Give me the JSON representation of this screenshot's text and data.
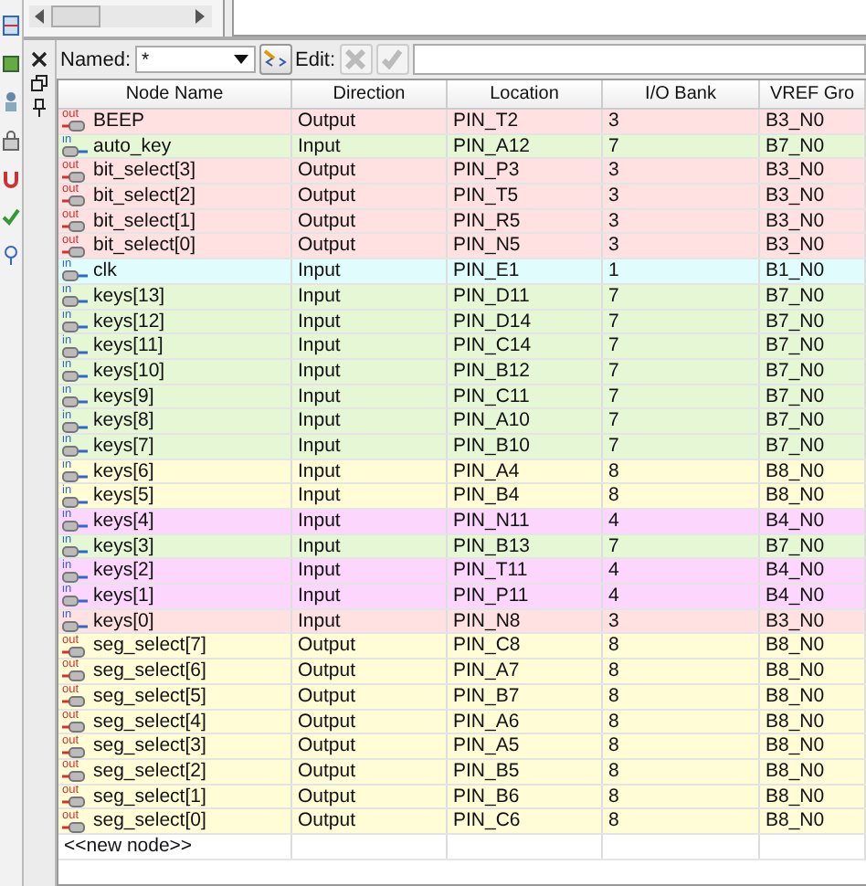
{
  "filter": {
    "label": "Named:",
    "value": "*",
    "edit_label": "Edit:"
  },
  "table": {
    "columns": [
      "Node Name",
      "Direction",
      "Location",
      "I/O Bank",
      "VREF Gro"
    ],
    "rows": [
      {
        "icon_text": "out",
        "kind": "output",
        "name": "BEEP",
        "direction": "Output",
        "location": "PIN_T2",
        "bank": "3",
        "vref": "B3_N0",
        "color": "#ffe1e1"
      },
      {
        "icon_text": "in",
        "kind": "input",
        "name": "auto_key",
        "direction": "Input",
        "location": "PIN_A12",
        "bank": "7",
        "vref": "B7_N0",
        "color": "#e6f7d6"
      },
      {
        "icon_text": "out",
        "kind": "output",
        "name": "bit_select[3]",
        "direction": "Output",
        "location": "PIN_P3",
        "bank": "3",
        "vref": "B3_N0",
        "color": "#ffe1e1"
      },
      {
        "icon_text": "out",
        "kind": "output",
        "name": "bit_select[2]",
        "direction": "Output",
        "location": "PIN_T5",
        "bank": "3",
        "vref": "B3_N0",
        "color": "#ffe1e1"
      },
      {
        "icon_text": "out",
        "kind": "output",
        "name": "bit_select[1]",
        "direction": "Output",
        "location": "PIN_R5",
        "bank": "3",
        "vref": "B3_N0",
        "color": "#ffe1e1"
      },
      {
        "icon_text": "out",
        "kind": "output",
        "name": "bit_select[0]",
        "direction": "Output",
        "location": "PIN_N5",
        "bank": "3",
        "vref": "B3_N0",
        "color": "#ffe1e1"
      },
      {
        "icon_text": "in",
        "kind": "input",
        "name": "clk",
        "direction": "Input",
        "location": "PIN_E1",
        "bank": "1",
        "vref": "B1_N0",
        "color": "#e1fcfc"
      },
      {
        "icon_text": "in",
        "kind": "input",
        "name": "keys[13]",
        "direction": "Input",
        "location": "PIN_D11",
        "bank": "7",
        "vref": "B7_N0",
        "color": "#e6f7d6"
      },
      {
        "icon_text": "in",
        "kind": "input",
        "name": "keys[12]",
        "direction": "Input",
        "location": "PIN_D14",
        "bank": "7",
        "vref": "B7_N0",
        "color": "#e6f7d6"
      },
      {
        "icon_text": "in",
        "kind": "input",
        "name": "keys[11]",
        "direction": "Input",
        "location": "PIN_C14",
        "bank": "7",
        "vref": "B7_N0",
        "color": "#e6f7d6"
      },
      {
        "icon_text": "in",
        "kind": "input",
        "name": "keys[10]",
        "direction": "Input",
        "location": "PIN_B12",
        "bank": "7",
        "vref": "B7_N0",
        "color": "#e6f7d6"
      },
      {
        "icon_text": "in",
        "kind": "input",
        "name": "keys[9]",
        "direction": "Input",
        "location": "PIN_C11",
        "bank": "7",
        "vref": "B7_N0",
        "color": "#e6f7d6"
      },
      {
        "icon_text": "in",
        "kind": "input",
        "name": "keys[8]",
        "direction": "Input",
        "location": "PIN_A10",
        "bank": "7",
        "vref": "B7_N0",
        "color": "#e6f7d6"
      },
      {
        "icon_text": "in",
        "kind": "input",
        "name": "keys[7]",
        "direction": "Input",
        "location": "PIN_B10",
        "bank": "7",
        "vref": "B7_N0",
        "color": "#e6f7d6"
      },
      {
        "icon_text": "in",
        "kind": "input",
        "name": "keys[6]",
        "direction": "Input",
        "location": "PIN_A4",
        "bank": "8",
        "vref": "B8_N0",
        "color": "#fffcd6"
      },
      {
        "icon_text": "in",
        "kind": "input",
        "name": "keys[5]",
        "direction": "Input",
        "location": "PIN_B4",
        "bank": "8",
        "vref": "B8_N0",
        "color": "#fffcd6"
      },
      {
        "icon_text": "in",
        "kind": "input",
        "name": "keys[4]",
        "direction": "Input",
        "location": "PIN_N11",
        "bank": "4",
        "vref": "B4_N0",
        "color": "#fcd6fc"
      },
      {
        "icon_text": "in",
        "kind": "input",
        "name": "keys[3]",
        "direction": "Input",
        "location": "PIN_B13",
        "bank": "7",
        "vref": "B7_N0",
        "color": "#e6f7d6"
      },
      {
        "icon_text": "in",
        "kind": "input",
        "name": "keys[2]",
        "direction": "Input",
        "location": "PIN_T11",
        "bank": "4",
        "vref": "B4_N0",
        "color": "#fcd6fc"
      },
      {
        "icon_text": "in",
        "kind": "input",
        "name": "keys[1]",
        "direction": "Input",
        "location": "PIN_P11",
        "bank": "4",
        "vref": "B4_N0",
        "color": "#fcd6fc"
      },
      {
        "icon_text": "in",
        "kind": "input",
        "name": "keys[0]",
        "direction": "Input",
        "location": "PIN_N8",
        "bank": "3",
        "vref": "B3_N0",
        "color": "#ffe1e1"
      },
      {
        "icon_text": "out",
        "kind": "output",
        "name": "seg_select[7]",
        "direction": "Output",
        "location": "PIN_C8",
        "bank": "8",
        "vref": "B8_N0",
        "color": "#fffcd6"
      },
      {
        "icon_text": "out",
        "kind": "output",
        "name": "seg_select[6]",
        "direction": "Output",
        "location": "PIN_A7",
        "bank": "8",
        "vref": "B8_N0",
        "color": "#fffcd6"
      },
      {
        "icon_text": "out",
        "kind": "output",
        "name": "seg_select[5]",
        "direction": "Output",
        "location": "PIN_B7",
        "bank": "8",
        "vref": "B8_N0",
        "color": "#fffcd6"
      },
      {
        "icon_text": "out",
        "kind": "output",
        "name": "seg_select[4]",
        "direction": "Output",
        "location": "PIN_A6",
        "bank": "8",
        "vref": "B8_N0",
        "color": "#fffcd6"
      },
      {
        "icon_text": "out",
        "kind": "output",
        "name": "seg_select[3]",
        "direction": "Output",
        "location": "PIN_A5",
        "bank": "8",
        "vref": "B8_N0",
        "color": "#fffcd6"
      },
      {
        "icon_text": "out",
        "kind": "output",
        "name": "seg_select[2]",
        "direction": "Output",
        "location": "PIN_B5",
        "bank": "8",
        "vref": "B8_N0",
        "color": "#fffcd6"
      },
      {
        "icon_text": "out",
        "kind": "output",
        "name": "seg_select[1]",
        "direction": "Output",
        "location": "PIN_B6",
        "bank": "8",
        "vref": "B8_N0",
        "color": "#fffcd6"
      },
      {
        "icon_text": "out",
        "kind": "output",
        "name": "seg_select[0]",
        "direction": "Output",
        "location": "PIN_C6",
        "bank": "8",
        "vref": "B8_N0",
        "color": "#fffcd6"
      }
    ],
    "new_row": "<<new node>>"
  }
}
